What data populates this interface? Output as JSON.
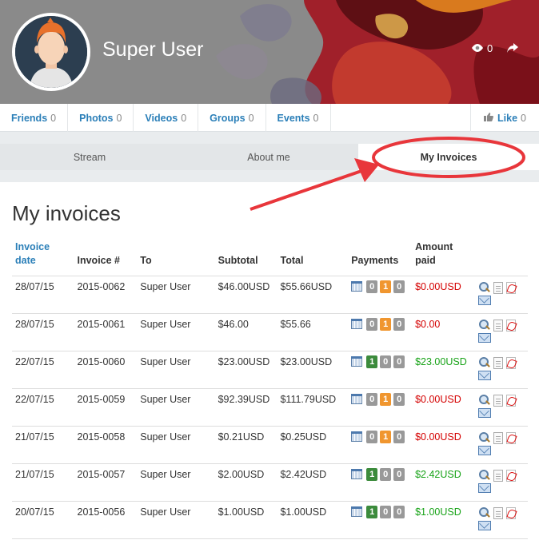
{
  "profile": {
    "name": "Super User",
    "views": "0"
  },
  "tabs": [
    {
      "label": "Friends",
      "count": "0"
    },
    {
      "label": "Photos",
      "count": "0"
    },
    {
      "label": "Videos",
      "count": "0"
    },
    {
      "label": "Groups",
      "count": "0"
    },
    {
      "label": "Events",
      "count": "0"
    }
  ],
  "like": {
    "label": "Like",
    "count": "0"
  },
  "subtabs": [
    "Stream",
    "About me",
    "My Invoices"
  ],
  "page": {
    "title": "My invoices"
  },
  "table": {
    "headers": {
      "date": "Invoice date",
      "number": "Invoice #",
      "to": "To",
      "subtotal": "Subtotal",
      "total": "Total",
      "payments": "Payments",
      "amount_paid": "Amount paid"
    },
    "rows": [
      {
        "date": "28/07/15",
        "number": "2015-0062",
        "to": "Super User",
        "subtotal": "$46.00USD",
        "total": "$55.66USD",
        "p": [
          "0",
          "1",
          "0"
        ],
        "pstyle": [
          "grey",
          "orange",
          "grey"
        ],
        "paid": "$0.00USD",
        "paid_state": "neg"
      },
      {
        "date": "28/07/15",
        "number": "2015-0061",
        "to": "Super User",
        "subtotal": "$46.00",
        "total": "$55.66",
        "p": [
          "0",
          "1",
          "0"
        ],
        "pstyle": [
          "grey",
          "orange",
          "grey"
        ],
        "paid": "$0.00",
        "paid_state": "neg"
      },
      {
        "date": "22/07/15",
        "number": "2015-0060",
        "to": "Super User",
        "subtotal": "$23.00USD",
        "total": "$23.00USD",
        "p": [
          "1",
          "0",
          "0"
        ],
        "pstyle": [
          "green",
          "grey",
          "grey"
        ],
        "paid": "$23.00USD",
        "paid_state": "pos"
      },
      {
        "date": "22/07/15",
        "number": "2015-0059",
        "to": "Super User",
        "subtotal": "$92.39USD",
        "total": "$111.79USD",
        "p": [
          "0",
          "1",
          "0"
        ],
        "pstyle": [
          "grey",
          "orange",
          "grey"
        ],
        "paid": "$0.00USD",
        "paid_state": "neg"
      },
      {
        "date": "21/07/15",
        "number": "2015-0058",
        "to": "Super User",
        "subtotal": "$0.21USD",
        "total": "$0.25USD",
        "p": [
          "0",
          "1",
          "0"
        ],
        "pstyle": [
          "grey",
          "orange",
          "grey"
        ],
        "paid": "$0.00USD",
        "paid_state": "neg"
      },
      {
        "date": "21/07/15",
        "number": "2015-0057",
        "to": "Super User",
        "subtotal": "$2.00USD",
        "total": "$2.42USD",
        "p": [
          "1",
          "0",
          "0"
        ],
        "pstyle": [
          "green",
          "grey",
          "grey"
        ],
        "paid": "$2.42USD",
        "paid_state": "pos"
      },
      {
        "date": "20/07/15",
        "number": "2015-0056",
        "to": "Super User",
        "subtotal": "$1.00USD",
        "total": "$1.00USD",
        "p": [
          "1",
          "0",
          "0"
        ],
        "pstyle": [
          "green",
          "grey",
          "grey"
        ],
        "paid": "$1.00USD",
        "paid_state": "pos"
      }
    ]
  },
  "colors": {
    "link": "#2b7fb8",
    "negative": "#d40000",
    "positive": "#18a318",
    "annotation": "#e8363b"
  }
}
